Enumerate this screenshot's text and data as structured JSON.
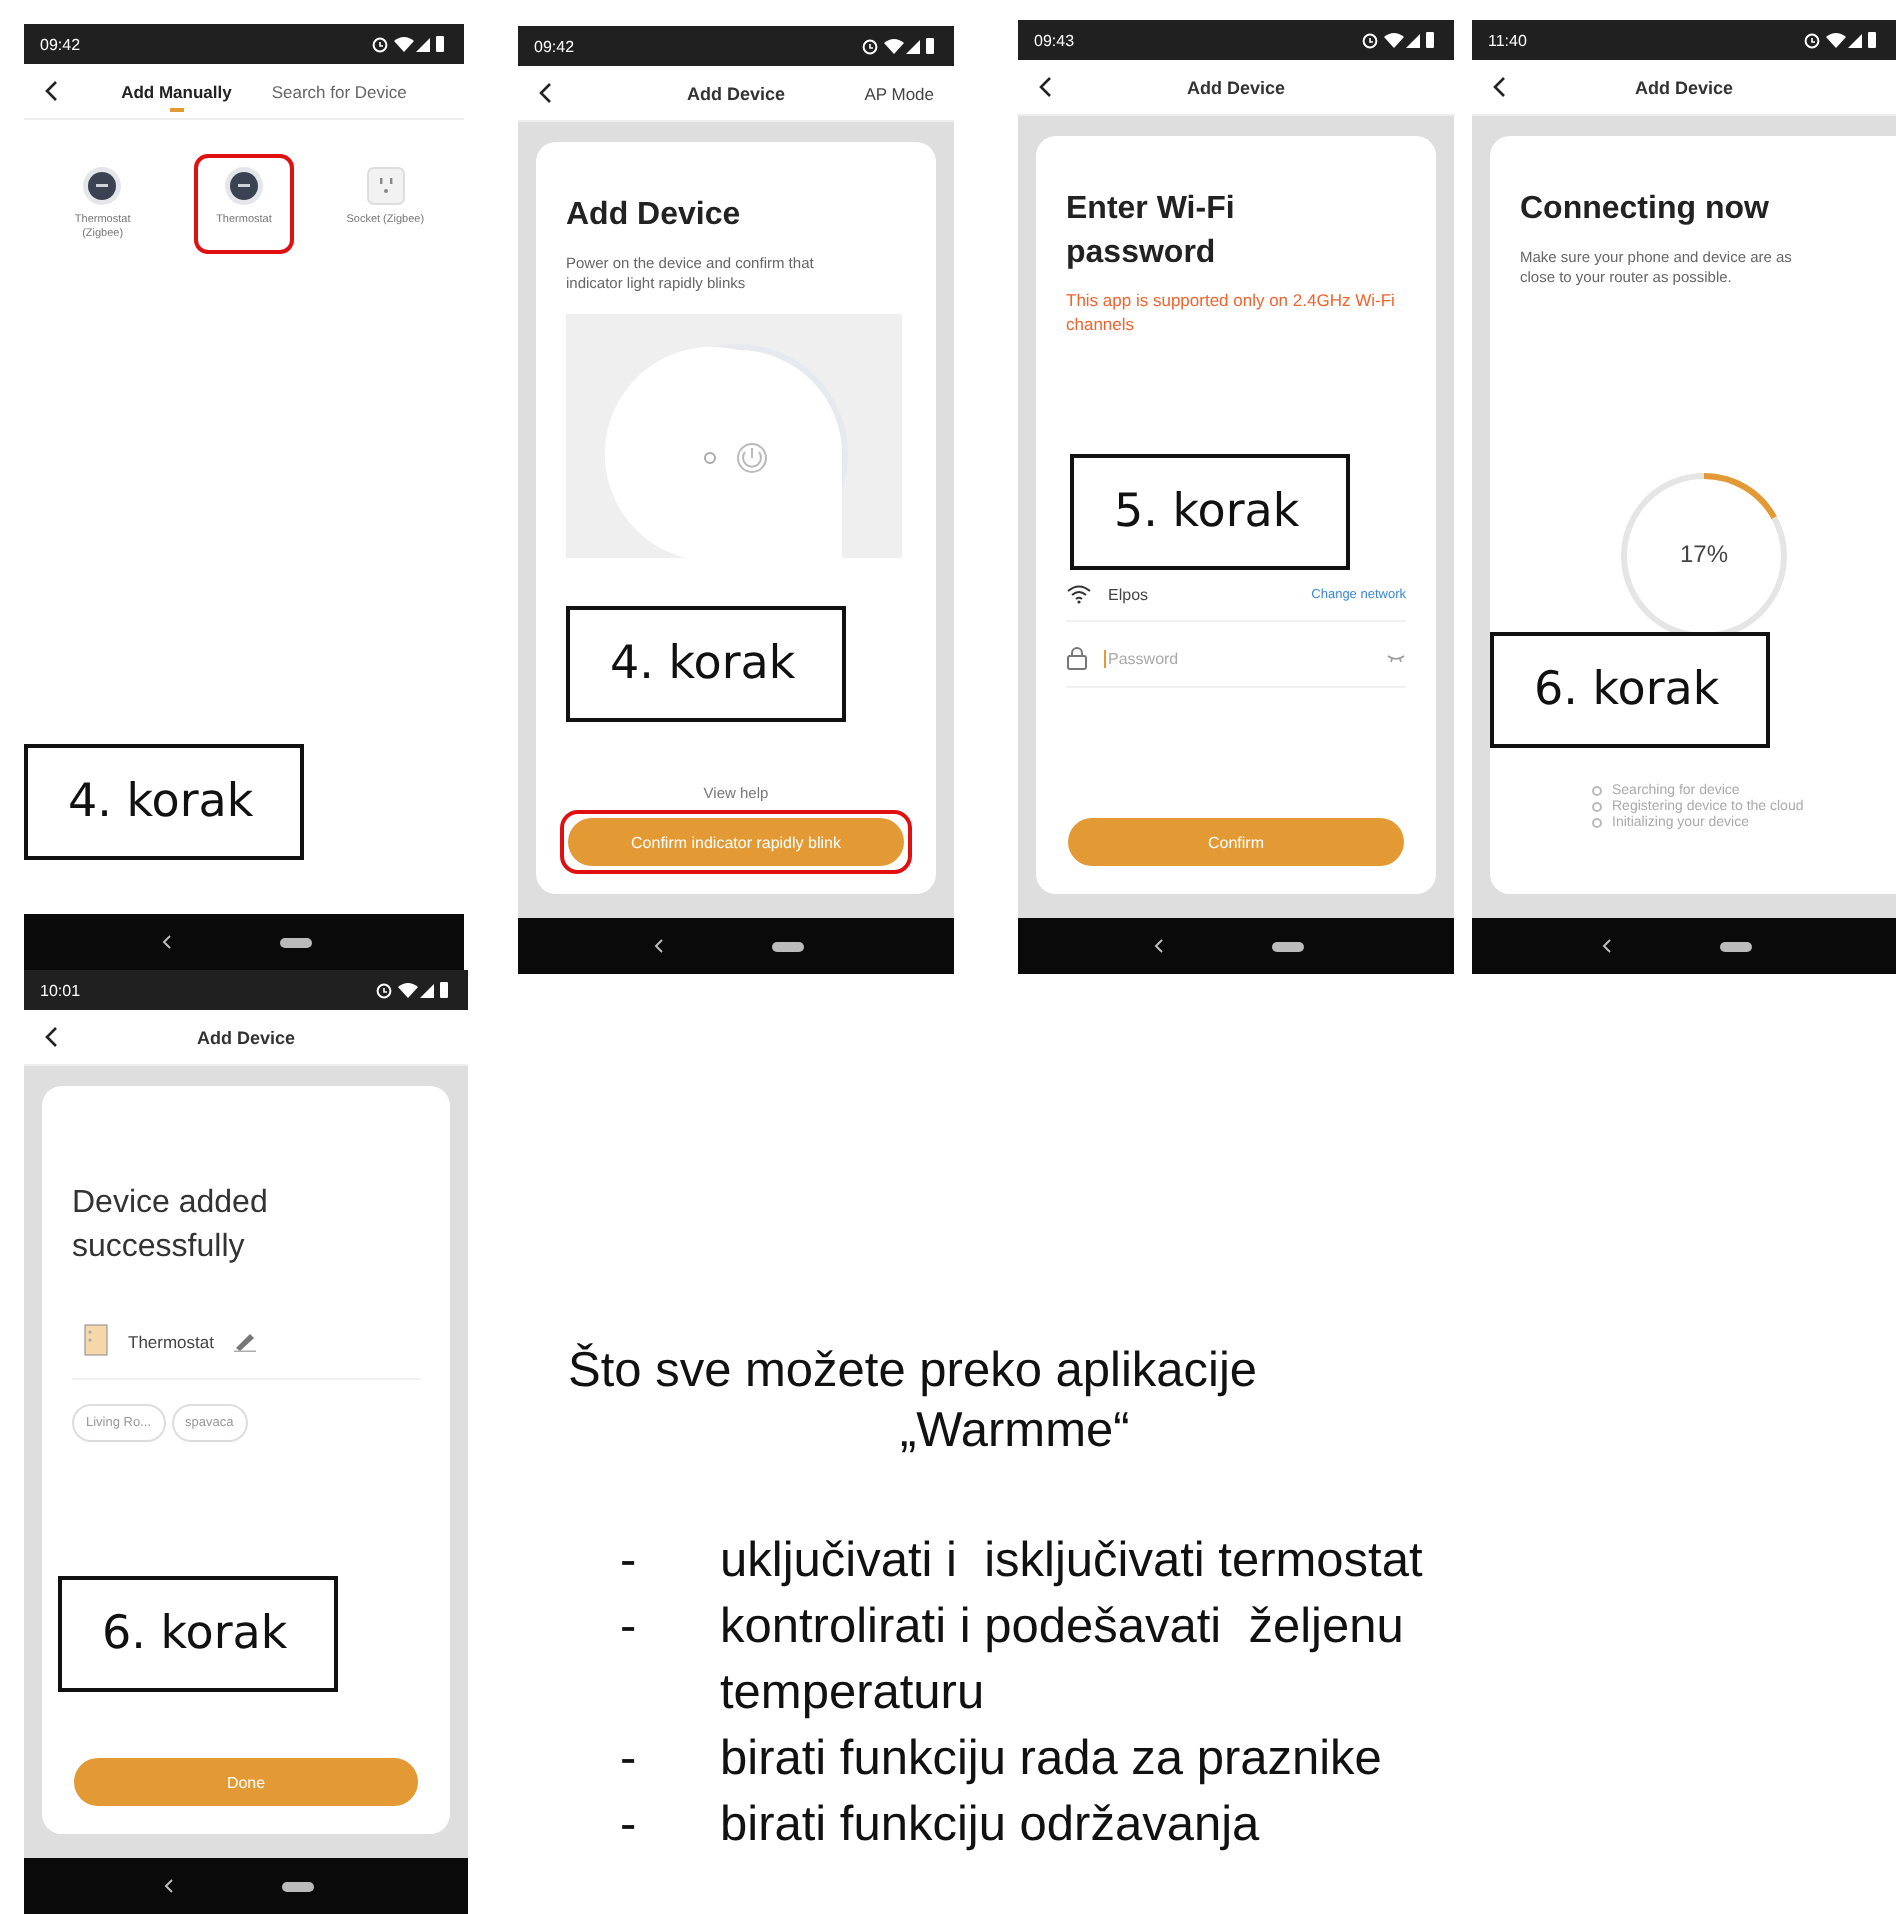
{
  "screens": [
    {
      "kind": "device_list",
      "time": "09:42",
      "header": {
        "title": "Add Manually",
        "action": "Search for Device"
      },
      "devices": [
        {
          "name": "Thermostat (Zigbee)",
          "kind": "thermostat",
          "highlighted": false
        },
        {
          "name": "Thermostat",
          "kind": "thermostat",
          "highlighted": true
        },
        {
          "name": "Socket (Zigbee)",
          "kind": "socket",
          "highlighted": false
        }
      ],
      "step_label": "4. korak"
    },
    {
      "kind": "instructions",
      "time": "09:42",
      "header": {
        "title": "Add Device",
        "action": "AP Mode"
      },
      "heading": "Add Device",
      "text": "Power on the device and confirm that indicator light rapidly blinks",
      "link": "View help",
      "button": {
        "label": "Confirm indicator rapidly blink",
        "highlighted": true
      },
      "step_label": "4. korak"
    },
    {
      "kind": "wifi",
      "time": "09:43",
      "header": {
        "title": "Add Device"
      },
      "heading": "Enter Wi-Fi password",
      "warning": "This app is supported only on 2.4GHz Wi-Fi channels",
      "network": "Elpos",
      "link": "Change network",
      "password": {
        "placeholder": "Password"
      },
      "button": {
        "label": "Confirm",
        "highlighted": false
      },
      "step_label": "5. korak"
    },
    {
      "kind": "connecting",
      "time": "11:40",
      "header": {
        "title": "Add Device"
      },
      "heading": "Connecting now",
      "text": "Make sure your phone and device are as close to your router as possible.",
      "progress": {
        "level": 0.17,
        "reading": "17%"
      },
      "steps": [
        "Searching for device",
        "Registering device to the cloud",
        "Initializing your device"
      ],
      "step_label": "6. korak"
    },
    {
      "kind": "success",
      "time": "10:01",
      "header": {
        "title": "Add Device"
      },
      "heading": "Device added successfully",
      "device": "Thermostat",
      "rooms": [
        "Living Ro...",
        "spavaca"
      ],
      "button": {
        "label": "Done",
        "highlighted": false
      },
      "step_label": "6. korak"
    }
  ],
  "features": {
    "title": "Što sve možete preko aplikacije",
    "app_name": "„Warmme“",
    "items": [
      {
        "bullet": "-",
        "text": "uključivati i  isključivati termostat"
      },
      {
        "bullet": "-",
        "text": "kontrolirati i podešavati  željenu temperaturu"
      },
      {
        "bullet": "-",
        "text": "birati funkciju rada za praznike"
      },
      {
        "bullet": "-",
        "text": "birati funkciju održavanja"
      }
    ]
  }
}
